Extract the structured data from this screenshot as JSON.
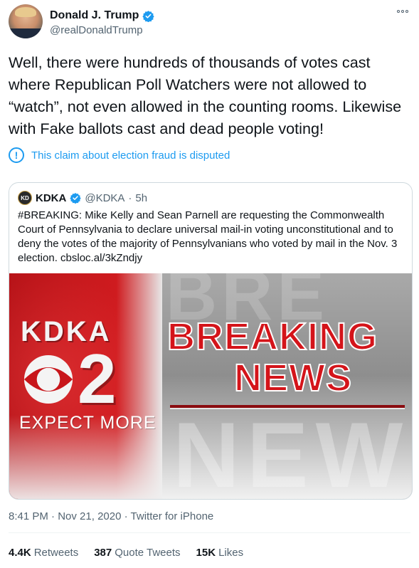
{
  "author": {
    "name": "Donald J. Trump",
    "handle": "@realDonaldTrump"
  },
  "tweet": {
    "text": "Well, there were hundreds of thousands of votes cast where Republican Poll Watchers were not allowed to “watch”, not even allowed in the counting rooms. Likewise with Fake ballots cast and dead people voting!",
    "disputed_label": "This claim about election fraud is disputed",
    "time": "8:41 PM",
    "date": "Nov 21, 2020",
    "source": "Twitter for iPhone"
  },
  "quoted": {
    "avatar_text": "KD",
    "name": "KDKA",
    "handle": "@KDKA",
    "age": "5h",
    "text": "#BREAKING: Mike Kelly and Sean Parnell are requesting the Commonwealth Court of Pennsylvania to declare universal mail-in voting unconstitutional and to deny the votes of the majority of Pennsylvanians who voted by mail in the Nov. 3 election. cbsloc.al/3kZndjy",
    "image": {
      "station": "KDKA",
      "channel": "2",
      "tagline": "EXPECT MORE",
      "headline_1": "BREAKING",
      "headline_2": "NEWS",
      "watermark_top": "BRE",
      "watermark_bottom": "NEW"
    }
  },
  "stats": {
    "retweets_count": "4.4K",
    "retweets_label": "Retweets",
    "quotes_count": "387",
    "quotes_label": "Quote Tweets",
    "likes_count": "15K",
    "likes_label": "Likes"
  },
  "separator": "·",
  "icons": {
    "verified": "verified-badge-icon",
    "more": "more-options-icon",
    "alert": "alert-circle-icon",
    "cbs_eye": "cbs-eye-logo-icon"
  },
  "colors": {
    "accent": "#1d9bf0",
    "text_primary": "#0f1419",
    "text_secondary": "#536471",
    "breaking_red": "#d4141a"
  }
}
